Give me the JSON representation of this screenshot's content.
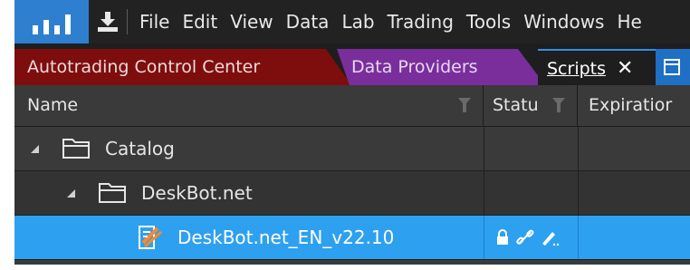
{
  "menu": {
    "items": [
      "File",
      "Edit",
      "View",
      "Data",
      "Lab",
      "Trading",
      "Tools",
      "Windows",
      "He"
    ]
  },
  "tabs": [
    {
      "label": "Autotrading Control Center",
      "color": "#7e0e0e"
    },
    {
      "label": "Data Providers",
      "color": "#7a2e9c"
    },
    {
      "label": "Scripts",
      "close": "✕",
      "active": true
    },
    {
      "label": "",
      "icon": "window-icon"
    }
  ],
  "columns": {
    "name": "Name",
    "status": "Statu",
    "expiration": "Expiratior"
  },
  "rows": [
    {
      "label": "Catalog",
      "icon": "folder-open-icon",
      "expanded": true
    },
    {
      "label": "DeskBot.net",
      "icon": "folder-open-icon",
      "expanded": true
    },
    {
      "label": "DeskBot.net_EN_v22.10",
      "icon": "script-icon",
      "selected": true,
      "status_icons": [
        "lock-icon",
        "link-icon",
        "edit-icon"
      ]
    }
  ],
  "colors": {
    "accent": "#2ea0f0",
    "logo": "#2f7fd0"
  }
}
